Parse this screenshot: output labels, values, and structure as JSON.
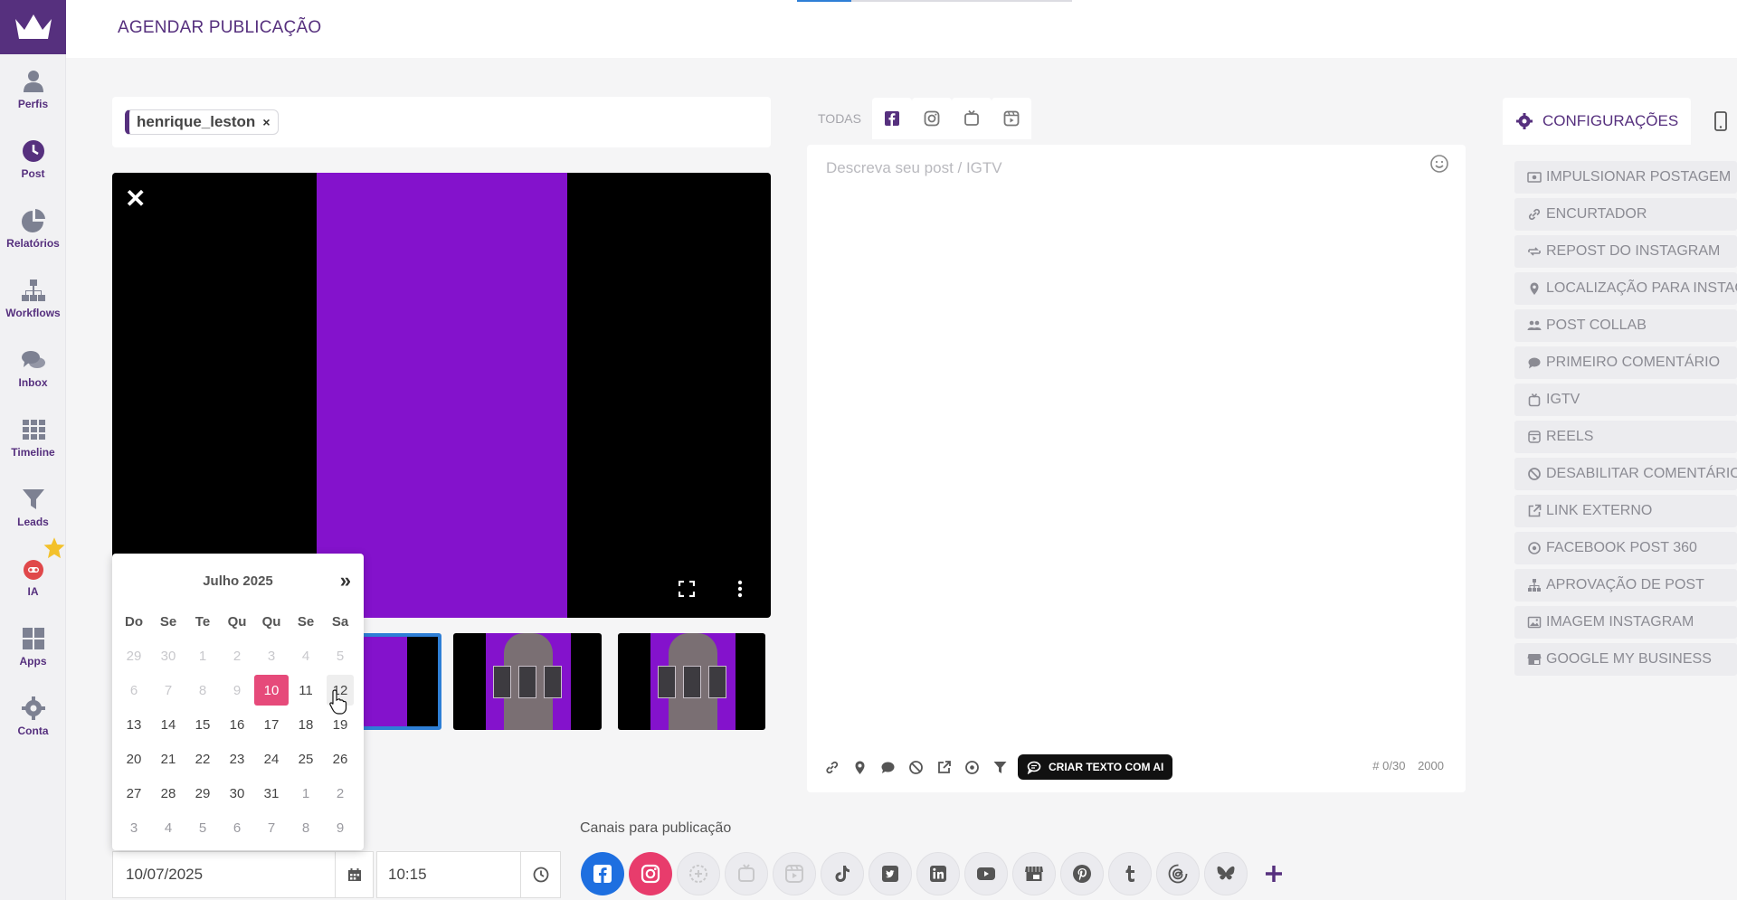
{
  "header": {
    "title": "AGENDAR PUBLICAÇÃO"
  },
  "nav": [
    {
      "label": "Perfis",
      "icon": "user-icon"
    },
    {
      "label": "Post",
      "icon": "clock-icon"
    },
    {
      "label": "Relatórios",
      "icon": "pie-chart-icon"
    },
    {
      "label": "Workflows",
      "icon": "sitemap-icon"
    },
    {
      "label": "Inbox",
      "icon": "chat-icon"
    },
    {
      "label": "Timeline",
      "icon": "grid-icon"
    },
    {
      "label": "Leads",
      "icon": "filter-icon"
    },
    {
      "label": "IA",
      "icon": "robot-icon"
    },
    {
      "label": "Apps",
      "icon": "apps-icon"
    },
    {
      "label": "Conta",
      "icon": "gear-icon"
    }
  ],
  "profile": {
    "tag": "henrique_leston",
    "remove": "×"
  },
  "preview": {
    "close": "✕"
  },
  "calendar": {
    "month_label": "Julho 2025",
    "next": "»",
    "weekdays": [
      "Do",
      "Se",
      "Te",
      "Qu",
      "Qu",
      "Se",
      "Sa"
    ],
    "weeks": [
      [
        "29",
        "30",
        "1",
        "2",
        "3",
        "4",
        "5"
      ],
      [
        "6",
        "7",
        "8",
        "9",
        "10",
        "11",
        "12"
      ],
      [
        "13",
        "14",
        "15",
        "16",
        "17",
        "18",
        "19"
      ],
      [
        "20",
        "21",
        "22",
        "23",
        "24",
        "25",
        "26"
      ],
      [
        "27",
        "28",
        "29",
        "30",
        "31",
        "1",
        "2"
      ],
      [
        "3",
        "4",
        "5",
        "6",
        "7",
        "8",
        "9"
      ]
    ],
    "selected_day": "10"
  },
  "date_value": "10/07/2025",
  "time_value": "10:15",
  "channels_label": "Canais para publicação",
  "editor": {
    "tabs_all": "TODAS",
    "placeholder": "Descreva seu post / IGTV",
    "ai_button": "CRIAR TEXTO COM AI",
    "hashtag_count": "# 0/30",
    "char_limit": "2000"
  },
  "config": {
    "tab": "CONFIGURAÇÕES",
    "items": [
      "IMPULSIONAR POSTAGEM",
      "ENCURTADOR",
      "REPOST DO INSTAGRAM",
      "LOCALIZAÇÃO PARA INSTAGRAM",
      "POST COLLAB",
      "PRIMEIRO COMENTÁRIO",
      "IGTV",
      "REELS",
      "DESABILITAR COMENTÁRIO",
      "LINK EXTERNO",
      "FACEBOOK POST 360",
      "APROVAÇÃO DE POST",
      "IMAGEM INSTAGRAM",
      "GOOGLE MY BUSINESS"
    ]
  },
  "colors": {
    "brand": "#56307e",
    "accent": "#8412cc",
    "today": "#e64a7a",
    "facebook": "#1e6fe0",
    "instagram": "#e83c6c"
  }
}
